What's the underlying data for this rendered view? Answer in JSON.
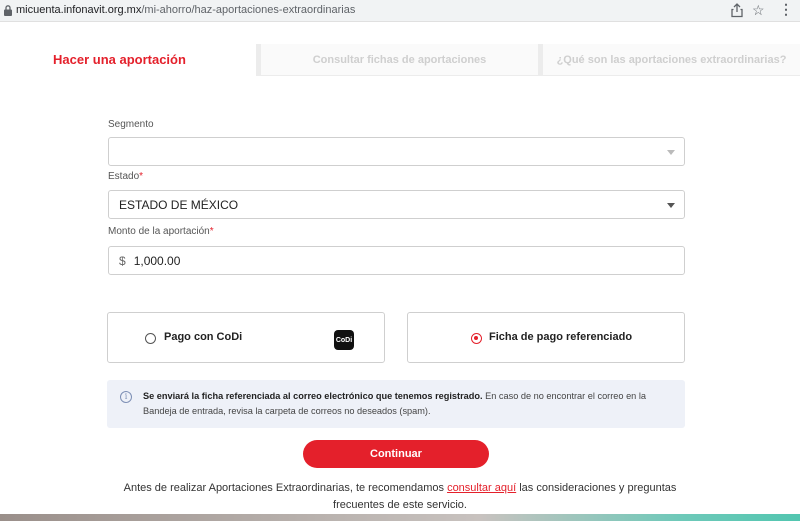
{
  "browser": {
    "url_host": "micuenta.infonavit.org.mx",
    "url_path": "/mi-ahorro/haz-aportaciones-extraordinarias"
  },
  "tabs": [
    {
      "label": "Hacer una aportación",
      "active": true
    },
    {
      "label": "Consultar fichas de aportaciones",
      "active": false
    },
    {
      "label": "¿Qué son las aportaciones extraordinarias?",
      "active": false
    }
  ],
  "form": {
    "segmento_label": "Segmento",
    "segmento_value": "",
    "estado_label": "Estado",
    "estado_value": "ESTADO DE MÉXICO",
    "monto_label": "Monto de la aportación",
    "currency_symbol": "$",
    "monto_value": "1,000.00",
    "required_mark": "*"
  },
  "payment": {
    "codi_label": "Pago con CoDi",
    "codi_logo_text": "CoDi",
    "ficha_label": "Ficha de pago referenciado",
    "selected": "ficha"
  },
  "info": {
    "icon": "info-icon",
    "bold": "Se enviará la ficha referenciada al correo electrónico que tenemos registrado.",
    "rest": " En caso de no encontrar el correo en la Bandeja de entrada, revisa la carpeta de correos no deseados (spam)."
  },
  "continue_label": "Continuar",
  "footer": {
    "before": "Antes de realizar Aportaciones Extraordinarias, te recomendamos ",
    "link": "consultar aquí",
    "after": " las consideraciones y preguntas frecuentes de este servicio."
  },
  "colors": {
    "accent": "#e4202b",
    "info_bg": "#eef1f8"
  }
}
